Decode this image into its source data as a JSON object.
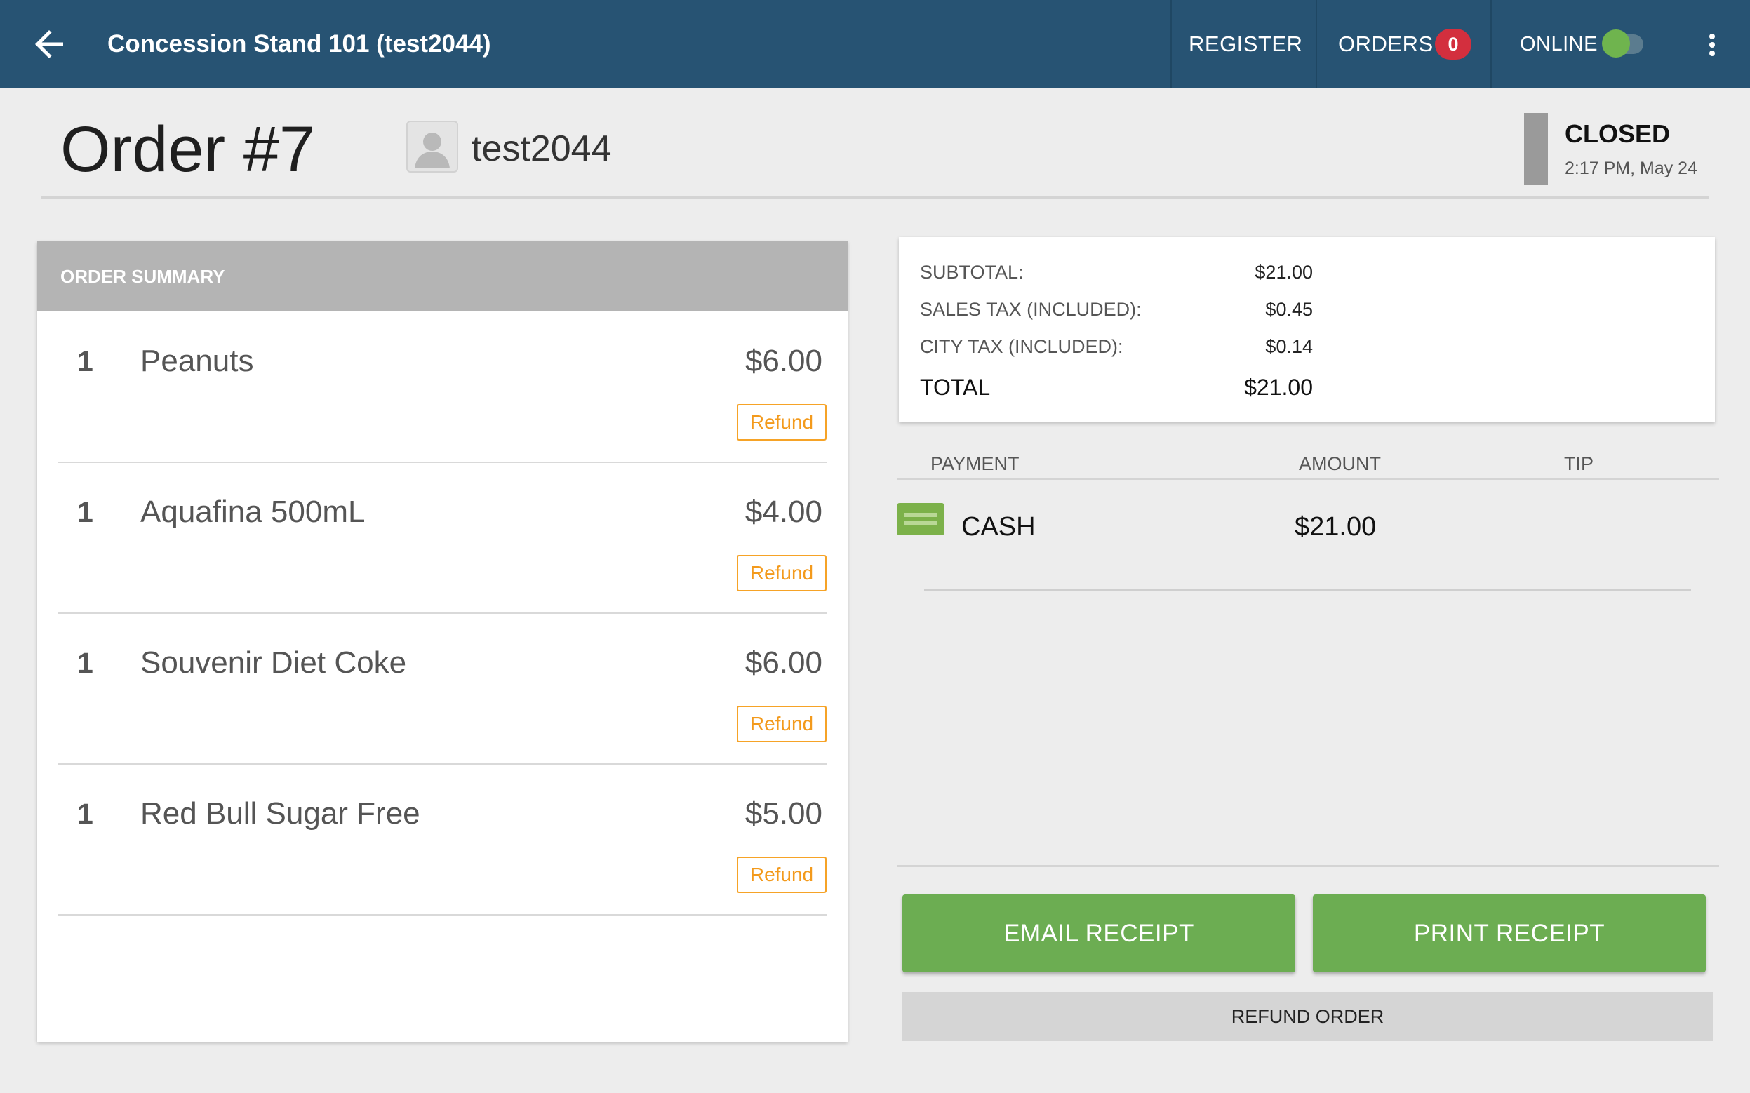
{
  "topbar": {
    "back_icon": "arrow-left-icon",
    "title": "Concession Stand 101 (test2044)",
    "nav": {
      "register": "REGISTER",
      "orders": "ORDERS",
      "orders_count": "0",
      "online": "ONLINE",
      "online_enabled": true
    },
    "more_icon": "more-vertical-icon",
    "colors": {
      "bar": "#275373",
      "badge": "#d32f3e",
      "toggle_on": "#6fb44e"
    }
  },
  "order": {
    "title": "Order #7",
    "customer_icon": "person-icon",
    "customer": "test2044",
    "status": "CLOSED",
    "status_time": "2:17 PM, May 24"
  },
  "summary": {
    "heading": "ORDER SUMMARY",
    "items": [
      {
        "qty": "1",
        "name": "Peanuts",
        "price": "$6.00",
        "refund_label": "Refund"
      },
      {
        "qty": "1",
        "name": "Aquafina 500mL",
        "price": "$4.00",
        "refund_label": "Refund"
      },
      {
        "qty": "1",
        "name": "Souvenir Diet Coke",
        "price": "$6.00",
        "refund_label": "Refund"
      },
      {
        "qty": "1",
        "name": "Red Bull Sugar Free",
        "price": "$5.00",
        "refund_label": "Refund"
      }
    ],
    "colors": {
      "refund": "#f39a1c"
    }
  },
  "totals": {
    "subtotal_label": "SUBTOTAL:",
    "subtotal": "$21.00",
    "sales_tax_label": "SALES TAX (INCLUDED):",
    "sales_tax": "$0.45",
    "city_tax_label": "CITY TAX (INCLUDED):",
    "city_tax": "$0.14",
    "total_label": "TOTAL",
    "total": "$21.00"
  },
  "payments": {
    "headers": {
      "payment": "PAYMENT",
      "amount": "AMOUNT",
      "tip": "TIP"
    },
    "rows": [
      {
        "icon": "cash-icon",
        "method": "CASH",
        "amount": "$21.00",
        "tip": ""
      }
    ]
  },
  "actions": {
    "email_receipt": "EMAIL RECEIPT",
    "print_receipt": "PRINT RECEIPT",
    "refund_order": "REFUND ORDER",
    "colors": {
      "primary": "#6cad52"
    }
  }
}
